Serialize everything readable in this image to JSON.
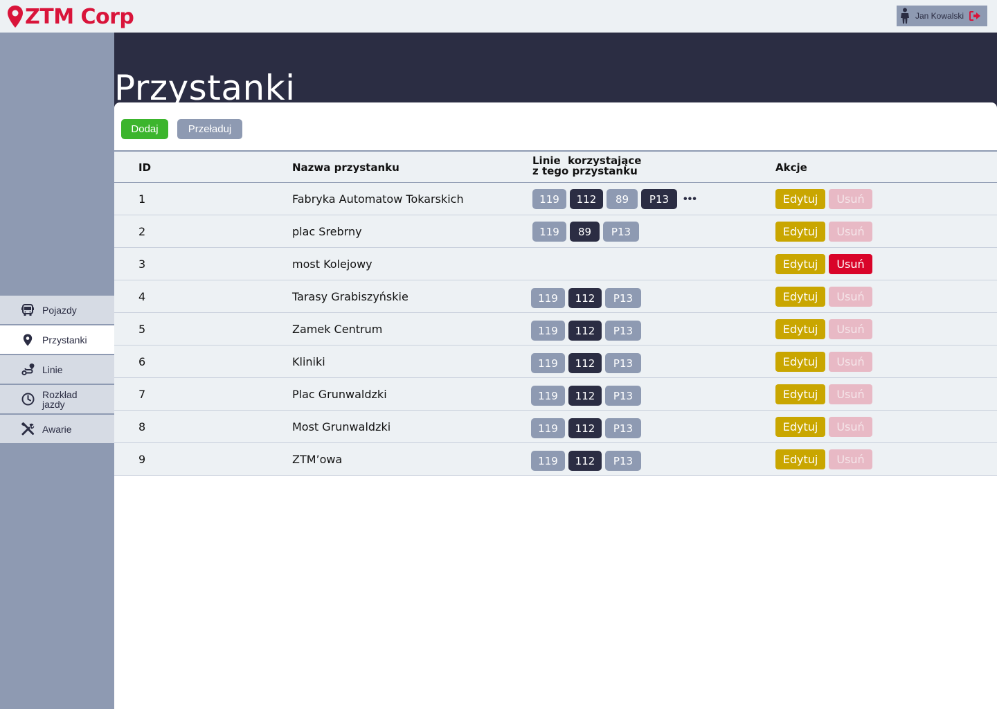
{
  "app": {
    "brand": "ZTM Corp",
    "user_name": "Jan Kowalski",
    "colors": {
      "accent_red": "#d9143a",
      "dark_navy": "#2b2d43",
      "slate": "#8e9ab2",
      "green": "#3cb52d",
      "gold": "#c9a600"
    }
  },
  "sidebar": {
    "items": [
      {
        "label": "Pojazdy",
        "icon": "bus-icon",
        "active": false
      },
      {
        "label": "Przystanki",
        "icon": "location-pin-icon",
        "active": true
      },
      {
        "label": "Linie",
        "icon": "route-icon",
        "active": false
      },
      {
        "label": "Rozkład jazdy",
        "icon": "clock-icon",
        "active": false
      },
      {
        "label": "Awarie",
        "icon": "tools-icon",
        "active": false
      }
    ]
  },
  "page": {
    "title": "Przystanki",
    "add_label": "Dodaj",
    "reload_label": "Przeładuj"
  },
  "table": {
    "headers": {
      "id": "ID",
      "name": "Nazwa przystanku",
      "lines": "Linie  korzystające\nz tego przystanku",
      "actions": "Akcje"
    },
    "edit_label": "Edytuj",
    "delete_label": "Usuń",
    "more_label": "•••",
    "rows": [
      {
        "id": "1",
        "name": "Fabryka Automatow Tokarskich",
        "lines": [
          {
            "label": "119",
            "style": "light"
          },
          {
            "label": "112",
            "style": "dark"
          },
          {
            "label": "89",
            "style": "light"
          },
          {
            "label": "P13",
            "style": "dark"
          }
        ],
        "more": true,
        "delete_enabled": false
      },
      {
        "id": "2",
        "name": "plac Srebrny",
        "lines": [
          {
            "label": "119",
            "style": "light"
          },
          {
            "label": "89",
            "style": "dark"
          },
          {
            "label": "P13",
            "style": "light"
          }
        ],
        "more": false,
        "delete_enabled": false
      },
      {
        "id": "3",
        "name": "most Kolejowy",
        "lines": [],
        "more": false,
        "delete_enabled": true
      },
      {
        "id": "4",
        "name": "Tarasy Grabiszyńskie",
        "lines": [
          {
            "label": "119",
            "style": "light"
          },
          {
            "label": "112",
            "style": "dark"
          },
          {
            "label": "P13",
            "style": "light"
          }
        ],
        "more": false,
        "delete_enabled": false
      },
      {
        "id": "5",
        "name": "Zamek Centrum",
        "lines": [
          {
            "label": "119",
            "style": "light"
          },
          {
            "label": "112",
            "style": "dark"
          },
          {
            "label": "P13",
            "style": "light"
          }
        ],
        "more": false,
        "delete_enabled": false
      },
      {
        "id": "6",
        "name": "Kliniki",
        "lines": [
          {
            "label": "119",
            "style": "light"
          },
          {
            "label": "112",
            "style": "dark"
          },
          {
            "label": "P13",
            "style": "light"
          }
        ],
        "more": false,
        "delete_enabled": false
      },
      {
        "id": "7",
        "name": "Plac Grunwaldzki",
        "lines": [
          {
            "label": "119",
            "style": "light"
          },
          {
            "label": "112",
            "style": "dark"
          },
          {
            "label": "P13",
            "style": "light"
          }
        ],
        "more": false,
        "delete_enabled": false
      },
      {
        "id": "8",
        "name": "Most Grunwaldzki",
        "lines": [
          {
            "label": "119",
            "style": "light"
          },
          {
            "label": "112",
            "style": "dark"
          },
          {
            "label": "P13",
            "style": "light"
          }
        ],
        "more": false,
        "delete_enabled": false
      },
      {
        "id": "9",
        "name": "ZTM’owa",
        "lines": [
          {
            "label": "119",
            "style": "light"
          },
          {
            "label": "112",
            "style": "dark"
          },
          {
            "label": "P13",
            "style": "light"
          }
        ],
        "more": false,
        "delete_enabled": false
      }
    ]
  }
}
